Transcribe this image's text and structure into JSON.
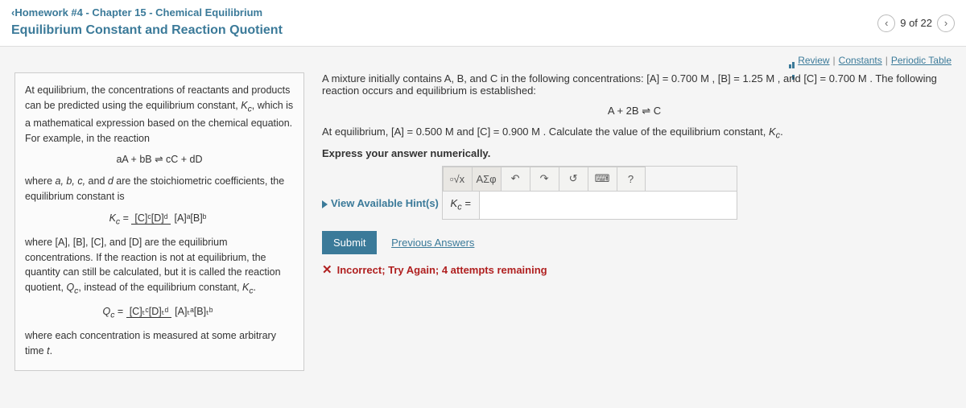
{
  "header": {
    "back_link": "Homework #4 - Chapter 15 - Chemical Equilibrium",
    "title": "Equilibrium Constant and Reaction Quotient",
    "pager": {
      "prev": "‹",
      "next": "›",
      "label": "9 of 22"
    }
  },
  "toplinks": {
    "review": "Review",
    "constants": "Constants",
    "periodic": "Periodic Table"
  },
  "left": {
    "p1a": "At equilibrium, the concentrations of reactants and products can be predicted using the equilibrium constant, ",
    "kc1": "K",
    "kc1sub": "c",
    "p1b": ", which is a mathematical expression based on the chemical equation. For example, in the reaction",
    "eq1": "aA + bB ⇌ cC + dD",
    "p2a": "where ",
    "coef": "a, b, c,",
    "p2b": " and ",
    "coef_d": "d",
    "p2c": " are the stoichiometric coefficients, the equilibrium constant is",
    "frac1": {
      "lhs": "K",
      "lhs_sub": "c",
      "eq": " = ",
      "num": "[C]ᶜ[D]ᵈ",
      "den": "[A]ᵃ[B]ᵇ"
    },
    "p3": "where [A], [B], [C], and [D] are the equilibrium concentrations. If the reaction is not at equilibrium, the quantity can still be calculated, but it is called the reaction quotient, ",
    "qc": "Q",
    "qcsub": "c",
    "p3b": ", instead of the equilibrium constant, ",
    "kc3": "K",
    "kc3sub": "c",
    "dot": ".",
    "frac2": {
      "lhs": "Q",
      "lhs_sub": "c",
      "eq": " = ",
      "num": "[C]ₜᶜ[D]ₜᵈ",
      "den": "[A]ₜᵃ[B]ₜᵇ"
    },
    "p4": "where each concentration is measured at some arbitrary time ",
    "t": "t",
    "dot2": "."
  },
  "right": {
    "intro": "A mixture initially contains A, B, and C in the following concentrations: [A] = 0.700 M , [B] = 1.25 M , and [C] = 0.700 M . The following reaction occurs and equilibrium is established:",
    "reaction": "A + 2B ⇌ C",
    "equil": "At equilibrium, [A] = 0.500 M and [C] = 0.900 M . Calculate the value of the equilibrium constant, ",
    "kc": "K",
    "kcsub": "c",
    "dot": ".",
    "express": "Express your answer numerically.",
    "hints": "View Available Hint(s)",
    "toolbar": {
      "t1": "▫√x",
      "t2": "ΑΣφ",
      "undo": "↶",
      "redo": "↷",
      "reset": "↺",
      "keyb": "⌨",
      "help": "?"
    },
    "input_label_pre": "K",
    "input_label_sub": "c",
    "input_label_post": " =",
    "input_value": "",
    "submit": "Submit",
    "prev_answers": "Previous Answers",
    "feedback": "Incorrect; Try Again; 4 attempts remaining"
  }
}
